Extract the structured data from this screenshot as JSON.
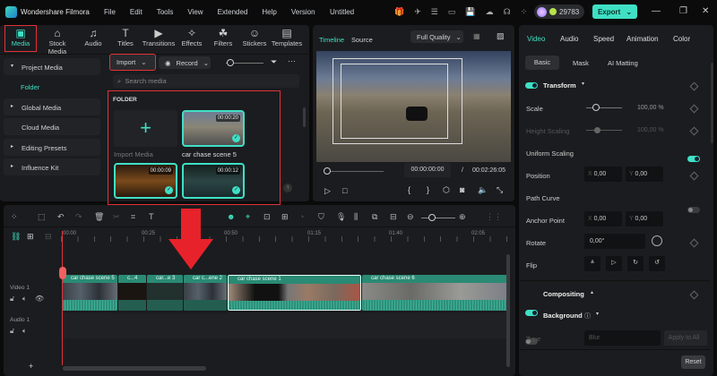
{
  "app": {
    "name": "Wondershare Filmora",
    "menu": [
      "File",
      "Edit",
      "Tools",
      "View",
      "Extended",
      "Help",
      "Version"
    ],
    "document": "Untitled",
    "credits": "29783",
    "export_label": "Export"
  },
  "toolbar": [
    {
      "label": "Media",
      "icon": "media-icon",
      "active": true
    },
    {
      "label": "Stock Media",
      "icon": "stock-icon"
    },
    {
      "label": "Audio",
      "icon": "music-icon"
    },
    {
      "label": "Titles",
      "icon": "titles-icon"
    },
    {
      "label": "Transitions",
      "icon": "transitions-icon"
    },
    {
      "label": "Effects",
      "icon": "effects-icon"
    },
    {
      "label": "Filters",
      "icon": "filters-icon"
    },
    {
      "label": "Stickers",
      "icon": "stickers-icon"
    },
    {
      "label": "Templates",
      "icon": "templates-icon"
    }
  ],
  "sidebar": {
    "project_media": "Project Media",
    "folder": "Folder",
    "items": [
      "Global Media",
      "Cloud Media",
      "Editing Presets",
      "Influence Kit"
    ]
  },
  "media": {
    "import_label": "Import",
    "record_label": "Record",
    "search_placeholder": "Search media",
    "folder_heading": "FOLDER",
    "import_media": "Import Media",
    "items": [
      {
        "name": "car chase scene 5",
        "duration": "00:00:20"
      },
      {
        "name": "",
        "duration": "00:00:09"
      },
      {
        "name": "",
        "duration": "00:00:12"
      }
    ]
  },
  "preview": {
    "tab_timeline": "Timeline",
    "tab_source": "Source",
    "quality": "Full Quality",
    "current_time": "00:00:00:00",
    "separator": "/",
    "total_time": "00:02:26:05"
  },
  "properties": {
    "tabs": [
      "Video",
      "Audio",
      "Speed",
      "Animation",
      "Color"
    ],
    "subtabs": [
      "Basic",
      "Mask",
      "AI Matting"
    ],
    "transform": "Transform",
    "scale_label": "Scale",
    "scale_value": "100,00",
    "scale_unit": "%",
    "height_label": "Height Scaling",
    "height_value": "100,00",
    "height_unit": "%",
    "uniform_label": "Uniform Scaling",
    "position_label": "Position",
    "pos_x": "0,00",
    "pos_y": "0,00",
    "x": "X",
    "y": "Y",
    "path_curve": "Path Curve",
    "anchor_label": "Anchor Point",
    "anchor_x": "0,00",
    "anchor_y": "0,00",
    "rotate_label": "Rotate",
    "rotate_value": "0,00°",
    "flip_label": "Flip",
    "compositing": "Compositing",
    "background": "Background",
    "type_label": "Type",
    "type_value": "Blur",
    "apply_all": "Apply to All",
    "reset": "Reset"
  },
  "timeline": {
    "ticks": [
      "00:00",
      "00:25",
      "00:50",
      "01:15",
      "01:40",
      "02:05"
    ],
    "video_track": "Video 1",
    "audio_track": "Audio 1",
    "clips": [
      "car chase scene 5",
      "c...4",
      "car...e 3",
      "car c...ene 2",
      "car chase scene 1",
      "car chase scene 6"
    ]
  },
  "colors": {
    "accent": "#3fe0c4",
    "highlight": "#e0323a",
    "clip": "#2f8f7a"
  }
}
